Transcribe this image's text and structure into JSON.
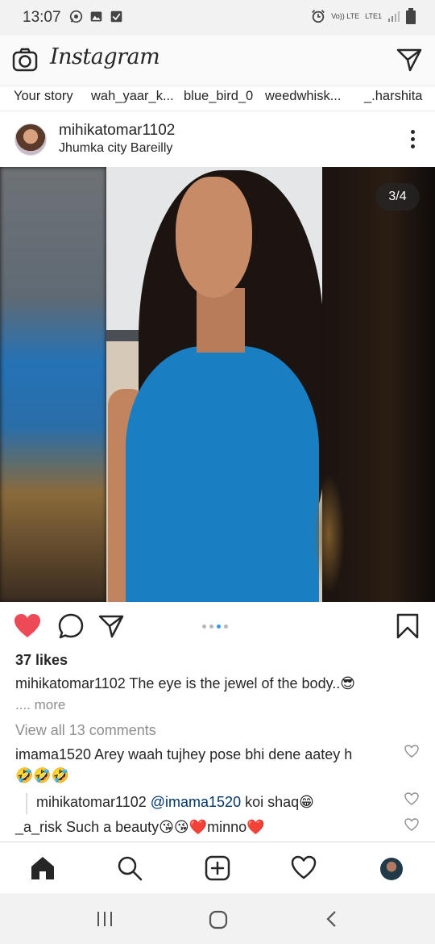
{
  "status_bar": {
    "time": "13:07",
    "volte_label": "Vo)) LTE",
    "lte_label": "LTE1"
  },
  "app": {
    "brand": "Instagram"
  },
  "stories": [
    "Your story",
    "wah_yaar_k...",
    "blue_bird_0",
    "weedwhisk...",
    "_.harshita"
  ],
  "post": {
    "username": "mihikatomar1102",
    "location": "Jhumka city Bareilly",
    "counter": "3/4",
    "likes": "37 likes",
    "caption_user": "mihikatomar1102",
    "caption_text": "The eye is the jewel of the body..😎",
    "more": ".... more",
    "view_all": "View all 13 comments",
    "carousel_active_index": 3,
    "carousel_total": 4
  },
  "comments": [
    {
      "user": "imama1520",
      "text": "Arey waah tujhey pose bhi dene aatey h",
      "text2": "🤣🤣🤣"
    },
    {
      "user": "mihikatomar1102",
      "mention": "@imama1520",
      "text": "koi shaq😁"
    },
    {
      "user": "_a_risk",
      "text": "Such a beauty😘😘❤️minno❤️"
    }
  ],
  "colors": {
    "like_red": "#ed4956",
    "active_dot": "#3897f0",
    "muted_text": "#8e8e8e"
  },
  "icons": {
    "header": [
      "camera-icon",
      "direct-message-icon"
    ],
    "actions": [
      "heart-filled-icon",
      "comment-icon",
      "share-icon",
      "bookmark-icon"
    ],
    "bottom_nav": [
      "home-icon",
      "search-icon",
      "add-post-icon",
      "activity-heart-icon",
      "profile-avatar"
    ],
    "system": [
      "recents-icon",
      "home-circle-icon",
      "back-icon"
    ]
  }
}
